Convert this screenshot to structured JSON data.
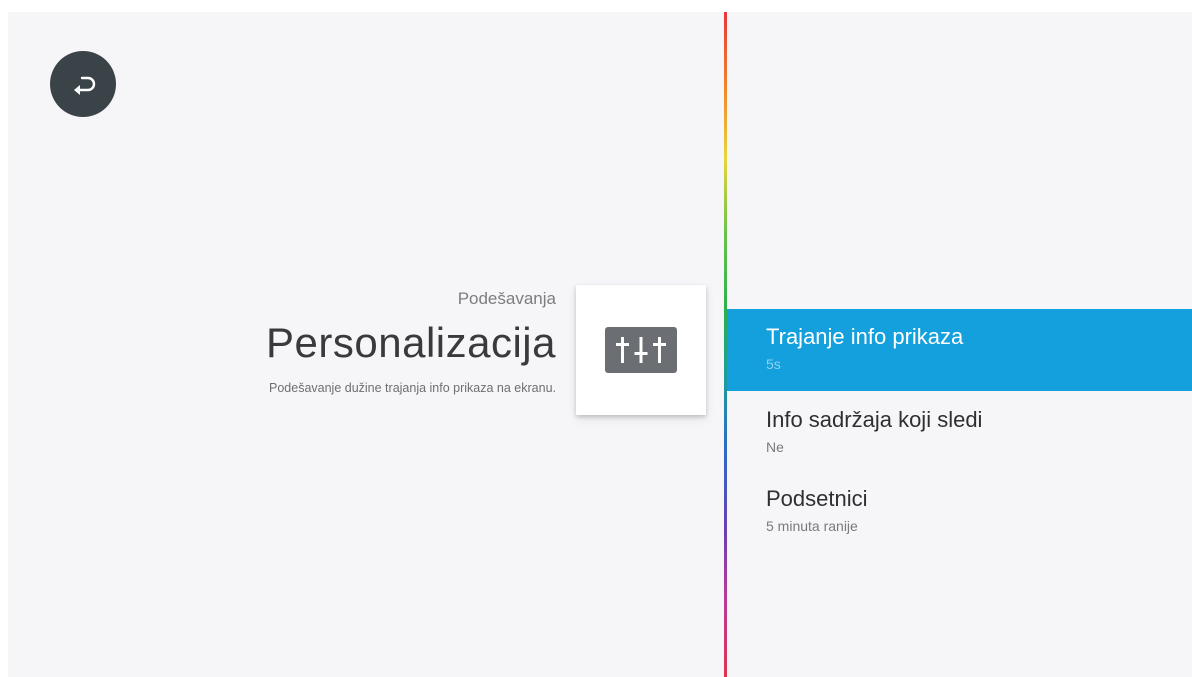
{
  "header": {
    "breadcrumb": "Podešavanja",
    "title": "Personalizacija",
    "description": "Podešavanje dužine trajanja info prikaza na ekranu."
  },
  "icons": {
    "back": "back-arrow-icon",
    "settings": "equalizer-sliders-icon"
  },
  "options": [
    {
      "title": "Trajanje info prikaza",
      "value": "5s",
      "selected": true
    },
    {
      "title": "Info sadržaja koji sledi",
      "value": "Ne",
      "selected": false
    },
    {
      "title": "Podsetnici",
      "value": "5 minuta ranije",
      "selected": false
    }
  ],
  "colors": {
    "background": "#f6f5f8",
    "selected_highlight": "#149fdd",
    "back_button": "#3a4448",
    "icon_badge": "#6b6f73"
  }
}
